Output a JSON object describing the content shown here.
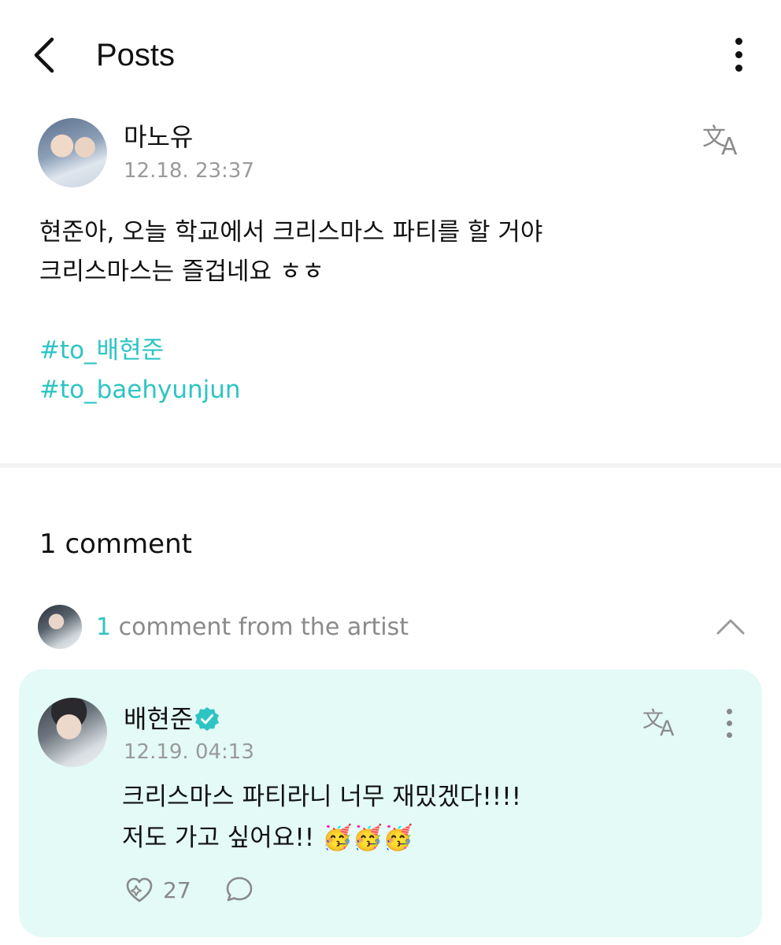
{
  "header": {
    "title": "Posts",
    "back_icon": "chevron-left-icon",
    "more_icon": "more-vertical-icon"
  },
  "post": {
    "author": "마노유",
    "timestamp": "12.18. 23:37",
    "translate_icon": "translate-icon",
    "body_lines": [
      "현준아, 오늘 학교에서 크리스마스 파티를 할 거야",
      "크리스마스는 즐겁네요 ㅎㅎ"
    ],
    "hashtags": [
      "#to_배현준",
      "#to_baehyunjun"
    ]
  },
  "comments": {
    "count_label": "1 comment",
    "artist_summary": {
      "count": "1",
      "label": " comment from the artist"
    },
    "items": [
      {
        "author": "배현준",
        "verified": true,
        "timestamp": "12.19. 04:13",
        "lines": [
          "크리스마스 파티라니 너무 재밌겠다!!!!",
          "저도 가고 싶어요!! 🥳🥳🥳"
        ],
        "likes": "27"
      }
    ]
  },
  "colors": {
    "accent": "#2ec4c4",
    "comment_bg": "#e3faf6",
    "muted_text": "#9a9a9a"
  }
}
